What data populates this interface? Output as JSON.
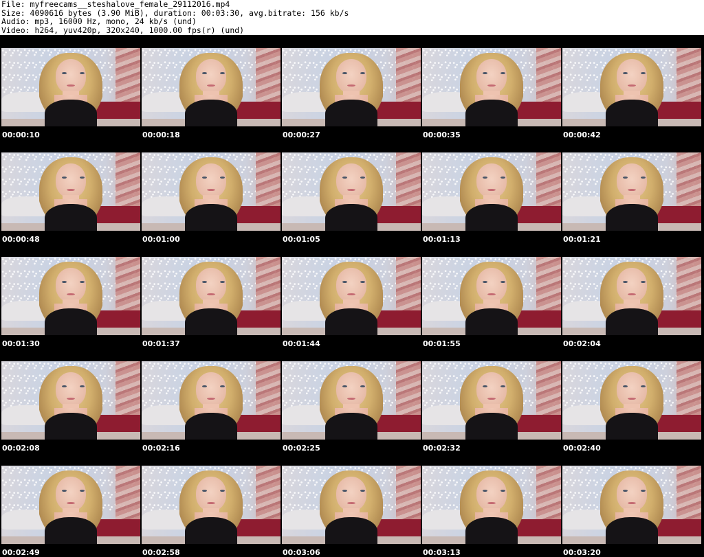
{
  "header": {
    "file": "File: myfreecams__steshalove_female_29112016.mp4",
    "size": "Size: 4090616 bytes (3.90 MiB), duration: 00:03:30, avg.bitrate: 156 kb/s",
    "audio": "Audio: mp3, 16000 Hz, mono, 24 kb/s (und)",
    "video": "Video: h264, yuv420p, 320x240, 1000.00 fps(r) (und)"
  },
  "thumbnails": [
    {
      "timestamp": "00:00:10"
    },
    {
      "timestamp": "00:00:18"
    },
    {
      "timestamp": "00:00:27"
    },
    {
      "timestamp": "00:00:35"
    },
    {
      "timestamp": "00:00:42"
    },
    {
      "timestamp": "00:00:48"
    },
    {
      "timestamp": "00:01:00"
    },
    {
      "timestamp": "00:01:05"
    },
    {
      "timestamp": "00:01:13"
    },
    {
      "timestamp": "00:01:21"
    },
    {
      "timestamp": "00:01:30"
    },
    {
      "timestamp": "00:01:37"
    },
    {
      "timestamp": "00:01:44"
    },
    {
      "timestamp": "00:01:55"
    },
    {
      "timestamp": "00:02:04"
    },
    {
      "timestamp": "00:02:08"
    },
    {
      "timestamp": "00:02:16"
    },
    {
      "timestamp": "00:02:25"
    },
    {
      "timestamp": "00:02:32"
    },
    {
      "timestamp": "00:02:40"
    },
    {
      "timestamp": "00:02:49"
    },
    {
      "timestamp": "00:02:58"
    },
    {
      "timestamp": "00:03:06"
    },
    {
      "timestamp": "00:03:13"
    },
    {
      "timestamp": "00:03:20"
    }
  ]
}
